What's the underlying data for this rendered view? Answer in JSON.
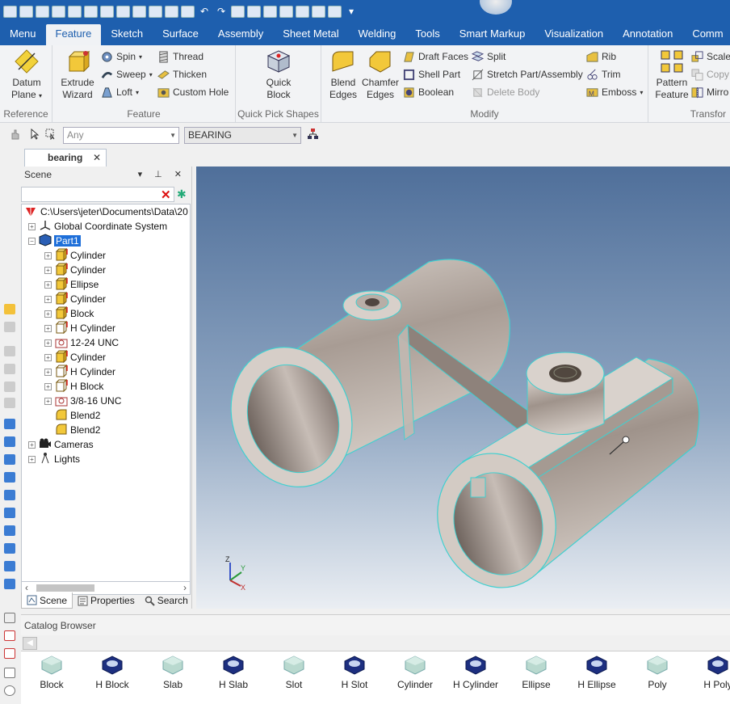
{
  "quick_access": {
    "icon_names": [
      "app-menu-icon",
      "new-icon",
      "new-part-icon",
      "new-drawing-icon",
      "new-icon",
      "new-icon",
      "open-icon",
      "save-icon",
      "edit-icon",
      "hand-icon",
      "transfer-icon",
      "transfer-icon",
      "undo-icon",
      "redo-icon",
      "smart-icon",
      "smart-snap-icon",
      "pattern-icon",
      "list-icon",
      "windows-icon",
      "help-icon",
      "share-icon",
      "more-icon"
    ]
  },
  "ribbon_tabs": [
    "Menu",
    "Feature",
    "Sketch",
    "Surface",
    "Assembly",
    "Sheet Metal",
    "Welding",
    "Tools",
    "Smart Markup",
    "Visualization",
    "Annotation",
    "Comm"
  ],
  "active_tab": "Feature",
  "ribbon": {
    "reference": {
      "label": "Reference",
      "datum_plane": "Datum\nPlane"
    },
    "feature": {
      "label": "Feature",
      "extrude": "Extrude\nWizard",
      "spin": "Spin",
      "sweep": "Sweep",
      "loft": "Loft",
      "thread": "Thread",
      "thicken": "Thicken",
      "custom_hole": "Custom Hole"
    },
    "quick_pick": {
      "label": "Quick Pick Shapes",
      "quick_block": "Quick\nBlock"
    },
    "modify": {
      "label": "Modify",
      "blend_edges": "Blend\nEdges",
      "chamfer_edges": "Chamfer\nEdges",
      "draft_faces": "Draft Faces",
      "shell_part": "Shell Part",
      "boolean": "Boolean",
      "split": "Split",
      "stretch": "Stretch Part/Assembly",
      "delete_body": "Delete Body",
      "rib": "Rib",
      "trim": "Trim",
      "emboss": "Emboss"
    },
    "transform": {
      "label": "Transfor",
      "pattern_feature": "Pattern\nFeature",
      "scale": "Scale",
      "copy": "Copy",
      "mirror": "Mirro"
    }
  },
  "toolbar2": {
    "filter_value": "Any",
    "part_value": "BEARING"
  },
  "document_tab": "bearing",
  "scene_panel": {
    "title": "Scene",
    "root_path": "C:\\Users\\jeter\\Documents\\Data\\20",
    "items": [
      {
        "label": "Global Coordinate System",
        "level": 1
      },
      {
        "label": "Part1",
        "level": 1
      },
      {
        "label": "Cylinder",
        "level": 2
      },
      {
        "label": "Cylinder",
        "level": 2
      },
      {
        "label": "Ellipse",
        "level": 2
      },
      {
        "label": "Cylinder",
        "level": 2
      },
      {
        "label": "Block",
        "level": 2
      },
      {
        "label": "H Cylinder",
        "level": 2
      },
      {
        "label": "12-24 UNC",
        "level": 2
      },
      {
        "label": "Cylinder",
        "level": 2
      },
      {
        "label": "H Cylinder",
        "level": 2
      },
      {
        "label": "H Block",
        "level": 2
      },
      {
        "label": "3/8-16 UNC",
        "level": 2
      },
      {
        "label": "Blend2",
        "level": 2
      },
      {
        "label": "Blend2",
        "level": 2
      },
      {
        "label": "Cameras",
        "level": 1
      },
      {
        "label": "Lights",
        "level": 1
      }
    ],
    "tabs": [
      "Scene",
      "Properties",
      "Search"
    ]
  },
  "viewport": {
    "axis_labels": [
      "Z",
      "Y",
      "X"
    ]
  },
  "catalog": {
    "title": "Catalog Browser",
    "items": [
      "Block",
      "H Block",
      "Slab",
      "H Slab",
      "Slot",
      "H Slot",
      "Cylinder",
      "H Cylinder",
      "Ellipse",
      "H Ellipse",
      "Poly",
      "H Poly"
    ]
  },
  "colors": {
    "ribbon_blue": "#1e5fae",
    "selection": "#1e6fd9",
    "model": "#c9c1ba",
    "edge_highlight": "#3fd0d0"
  }
}
